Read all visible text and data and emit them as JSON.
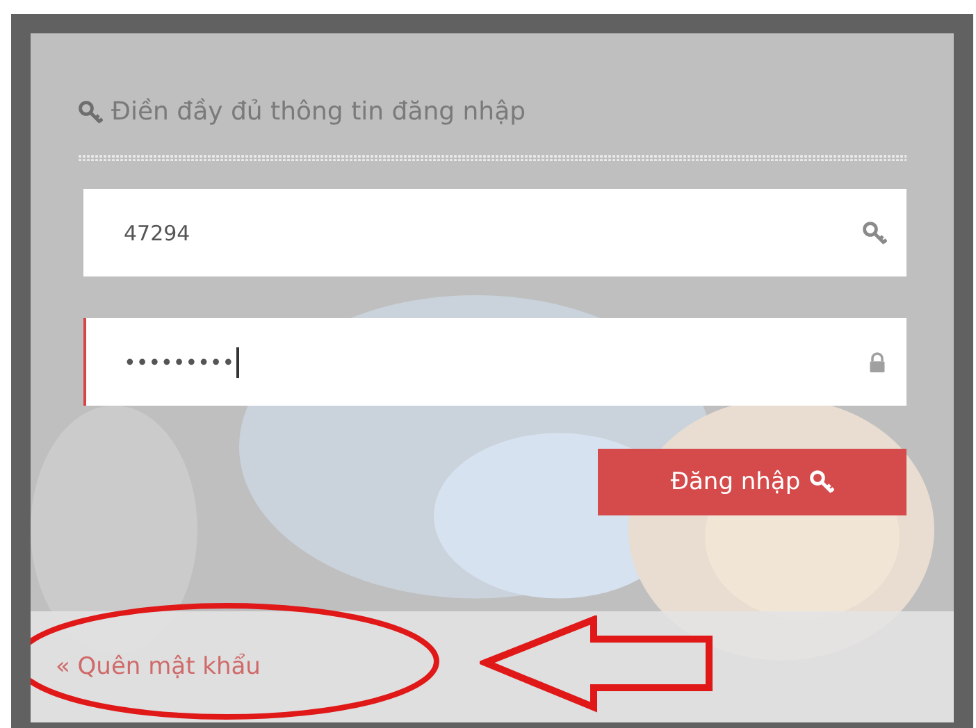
{
  "panel": {
    "heading": "Điền đầy đủ thông tin đăng nhập",
    "fields": [
      {
        "kind": "text",
        "value": "47294",
        "focused": false
      },
      {
        "kind": "password",
        "value": "•••••••••",
        "focused": true
      }
    ],
    "submit": "Đăng nhập",
    "forgot_link": "« Quên mật khẩu"
  },
  "markup": [
    {
      "kind": "ellipse"
    },
    {
      "kind": "arrow"
    }
  ]
}
